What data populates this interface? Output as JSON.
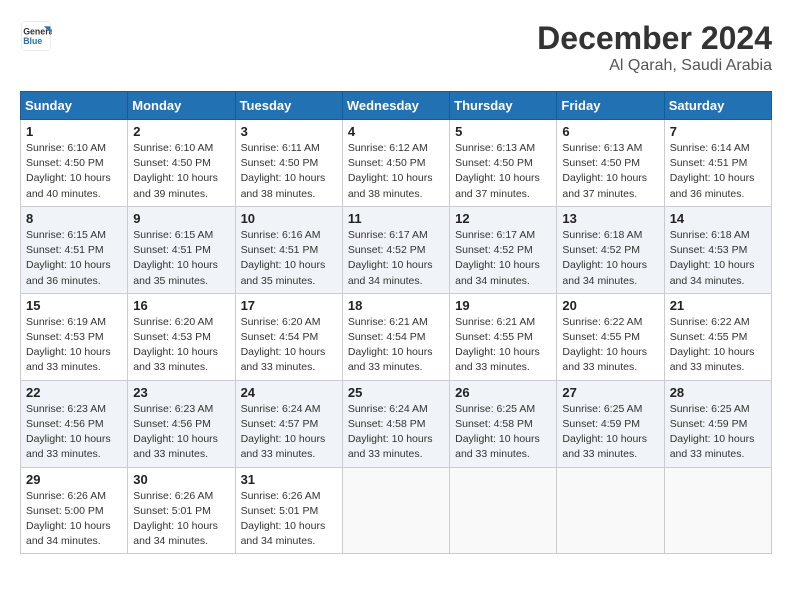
{
  "logo": {
    "line1": "General",
    "line2": "Blue"
  },
  "header": {
    "month_year": "December 2024",
    "location": "Al Qarah, Saudi Arabia"
  },
  "days_of_week": [
    "Sunday",
    "Monday",
    "Tuesday",
    "Wednesday",
    "Thursday",
    "Friday",
    "Saturday"
  ],
  "weeks": [
    [
      {
        "day": "1",
        "info": "Sunrise: 6:10 AM\nSunset: 4:50 PM\nDaylight: 10 hours\nand 40 minutes."
      },
      {
        "day": "2",
        "info": "Sunrise: 6:10 AM\nSunset: 4:50 PM\nDaylight: 10 hours\nand 39 minutes."
      },
      {
        "day": "3",
        "info": "Sunrise: 6:11 AM\nSunset: 4:50 PM\nDaylight: 10 hours\nand 38 minutes."
      },
      {
        "day": "4",
        "info": "Sunrise: 6:12 AM\nSunset: 4:50 PM\nDaylight: 10 hours\nand 38 minutes."
      },
      {
        "day": "5",
        "info": "Sunrise: 6:13 AM\nSunset: 4:50 PM\nDaylight: 10 hours\nand 37 minutes."
      },
      {
        "day": "6",
        "info": "Sunrise: 6:13 AM\nSunset: 4:50 PM\nDaylight: 10 hours\nand 37 minutes."
      },
      {
        "day": "7",
        "info": "Sunrise: 6:14 AM\nSunset: 4:51 PM\nDaylight: 10 hours\nand 36 minutes."
      }
    ],
    [
      {
        "day": "8",
        "info": "Sunrise: 6:15 AM\nSunset: 4:51 PM\nDaylight: 10 hours\nand 36 minutes."
      },
      {
        "day": "9",
        "info": "Sunrise: 6:15 AM\nSunset: 4:51 PM\nDaylight: 10 hours\nand 35 minutes."
      },
      {
        "day": "10",
        "info": "Sunrise: 6:16 AM\nSunset: 4:51 PM\nDaylight: 10 hours\nand 35 minutes."
      },
      {
        "day": "11",
        "info": "Sunrise: 6:17 AM\nSunset: 4:52 PM\nDaylight: 10 hours\nand 34 minutes."
      },
      {
        "day": "12",
        "info": "Sunrise: 6:17 AM\nSunset: 4:52 PM\nDaylight: 10 hours\nand 34 minutes."
      },
      {
        "day": "13",
        "info": "Sunrise: 6:18 AM\nSunset: 4:52 PM\nDaylight: 10 hours\nand 34 minutes."
      },
      {
        "day": "14",
        "info": "Sunrise: 6:18 AM\nSunset: 4:53 PM\nDaylight: 10 hours\nand 34 minutes."
      }
    ],
    [
      {
        "day": "15",
        "info": "Sunrise: 6:19 AM\nSunset: 4:53 PM\nDaylight: 10 hours\nand 33 minutes."
      },
      {
        "day": "16",
        "info": "Sunrise: 6:20 AM\nSunset: 4:53 PM\nDaylight: 10 hours\nand 33 minutes."
      },
      {
        "day": "17",
        "info": "Sunrise: 6:20 AM\nSunset: 4:54 PM\nDaylight: 10 hours\nand 33 minutes."
      },
      {
        "day": "18",
        "info": "Sunrise: 6:21 AM\nSunset: 4:54 PM\nDaylight: 10 hours\nand 33 minutes."
      },
      {
        "day": "19",
        "info": "Sunrise: 6:21 AM\nSunset: 4:55 PM\nDaylight: 10 hours\nand 33 minutes."
      },
      {
        "day": "20",
        "info": "Sunrise: 6:22 AM\nSunset: 4:55 PM\nDaylight: 10 hours\nand 33 minutes."
      },
      {
        "day": "21",
        "info": "Sunrise: 6:22 AM\nSunset: 4:55 PM\nDaylight: 10 hours\nand 33 minutes."
      }
    ],
    [
      {
        "day": "22",
        "info": "Sunrise: 6:23 AM\nSunset: 4:56 PM\nDaylight: 10 hours\nand 33 minutes."
      },
      {
        "day": "23",
        "info": "Sunrise: 6:23 AM\nSunset: 4:56 PM\nDaylight: 10 hours\nand 33 minutes."
      },
      {
        "day": "24",
        "info": "Sunrise: 6:24 AM\nSunset: 4:57 PM\nDaylight: 10 hours\nand 33 minutes."
      },
      {
        "day": "25",
        "info": "Sunrise: 6:24 AM\nSunset: 4:58 PM\nDaylight: 10 hours\nand 33 minutes."
      },
      {
        "day": "26",
        "info": "Sunrise: 6:25 AM\nSunset: 4:58 PM\nDaylight: 10 hours\nand 33 minutes."
      },
      {
        "day": "27",
        "info": "Sunrise: 6:25 AM\nSunset: 4:59 PM\nDaylight: 10 hours\nand 33 minutes."
      },
      {
        "day": "28",
        "info": "Sunrise: 6:25 AM\nSunset: 4:59 PM\nDaylight: 10 hours\nand 33 minutes."
      }
    ],
    [
      {
        "day": "29",
        "info": "Sunrise: 6:26 AM\nSunset: 5:00 PM\nDaylight: 10 hours\nand 34 minutes."
      },
      {
        "day": "30",
        "info": "Sunrise: 6:26 AM\nSunset: 5:01 PM\nDaylight: 10 hours\nand 34 minutes."
      },
      {
        "day": "31",
        "info": "Sunrise: 6:26 AM\nSunset: 5:01 PM\nDaylight: 10 hours\nand 34 minutes."
      },
      {
        "day": "",
        "info": ""
      },
      {
        "day": "",
        "info": ""
      },
      {
        "day": "",
        "info": ""
      },
      {
        "day": "",
        "info": ""
      }
    ]
  ]
}
